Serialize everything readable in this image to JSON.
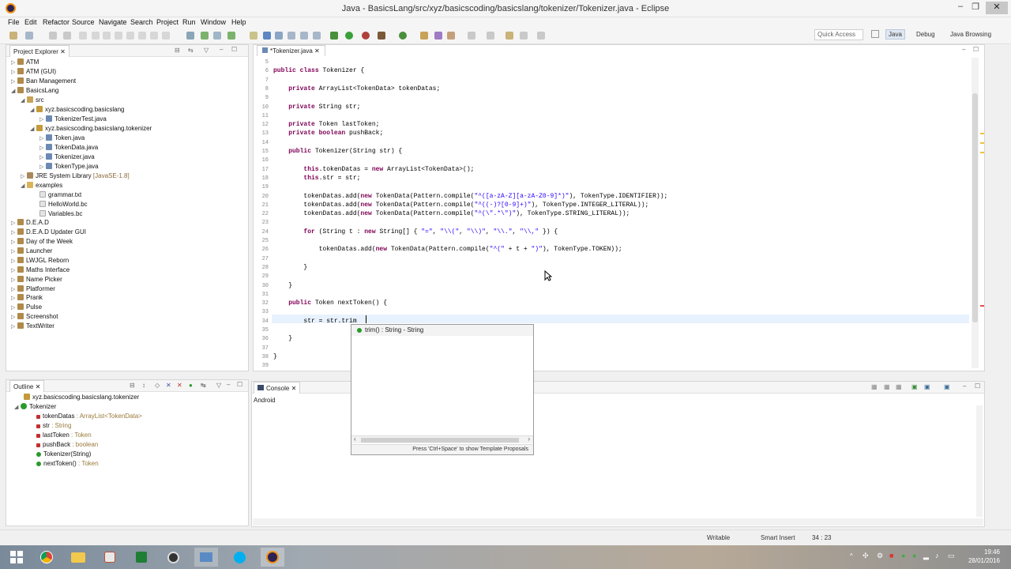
{
  "window": {
    "title": "Java - BasicsLang/src/xyz/basicscoding/basicslang/tokenizer/Tokenizer.java - Eclipse"
  },
  "menu": [
    "File",
    "Edit",
    "Refactor",
    "Source",
    "Navigate",
    "Search",
    "Project",
    "Run",
    "Window",
    "Help"
  ],
  "toolbar": {
    "quick_access": "Quick Access",
    "perspectives": [
      "Java",
      "Debug",
      "Java Browsing"
    ]
  },
  "project_explorer": {
    "title": "Project Explorer",
    "items": [
      {
        "label": "ATM",
        "suffix": ""
      },
      {
        "label": "ATM (GUI)",
        "suffix": ""
      },
      {
        "label": "Ban Management",
        "suffix": ""
      },
      {
        "label": "BasicsLang",
        "suffix": ""
      },
      {
        "label": "src",
        "suffix": ""
      },
      {
        "label": "xyz.basicscoding.basicslang",
        "suffix": ""
      },
      {
        "label": "TokenizerTest.java",
        "suffix": ""
      },
      {
        "label": "xyz.basicscoding.basicslang.tokenizer",
        "suffix": ""
      },
      {
        "label": "Token.java",
        "suffix": ""
      },
      {
        "label": "TokenData.java",
        "suffix": ""
      },
      {
        "label": "Tokenizer.java",
        "suffix": ""
      },
      {
        "label": "TokenType.java",
        "suffix": ""
      },
      {
        "label": "JRE System Library",
        "suffix": "[JavaSE-1.8]"
      },
      {
        "label": "examples",
        "suffix": ""
      },
      {
        "label": "grammar.txt",
        "suffix": ""
      },
      {
        "label": "HelloWorld.bc",
        "suffix": ""
      },
      {
        "label": "Variables.bc",
        "suffix": ""
      },
      {
        "label": "D.E.A.D",
        "suffix": ""
      },
      {
        "label": "D.E.A.D Updater GUI",
        "suffix": ""
      },
      {
        "label": "Day of the Week",
        "suffix": ""
      },
      {
        "label": "Launcher",
        "suffix": ""
      },
      {
        "label": "LWJGL Reborn",
        "suffix": ""
      },
      {
        "label": "Maths Interface",
        "suffix": ""
      },
      {
        "label": "Name Picker",
        "suffix": ""
      },
      {
        "label": "Platformer",
        "suffix": ""
      },
      {
        "label": "Prank",
        "suffix": ""
      },
      {
        "label": "Pulse",
        "suffix": ""
      },
      {
        "label": "Screenshot",
        "suffix": ""
      },
      {
        "label": "TextWriter",
        "suffix": ""
      }
    ]
  },
  "outline": {
    "title": "Outline",
    "items": [
      {
        "label": "xyz.basicscoding.basicslang.tokenizer",
        "suffix": ""
      },
      {
        "label": "Tokenizer",
        "suffix": ""
      },
      {
        "label": "tokenDatas",
        "suffix": " : ArrayList<TokenData>"
      },
      {
        "label": "str",
        "suffix": " : String"
      },
      {
        "label": "lastToken",
        "suffix": " : Token"
      },
      {
        "label": "pushBack",
        "suffix": " : boolean"
      },
      {
        "label": "Tokenizer(String)",
        "suffix": ""
      },
      {
        "label": "nextToken()",
        "suffix": " : Token"
      }
    ]
  },
  "editor": {
    "tab": "*Tokenizer.java",
    "lines": [
      {
        "n": "5",
        "t": ""
      },
      {
        "n": "6",
        "t": "public class Tokenizer {"
      },
      {
        "n": "7",
        "t": ""
      },
      {
        "n": "8",
        "t": "    private ArrayList<TokenData> tokenDatas;"
      },
      {
        "n": "9",
        "t": ""
      },
      {
        "n": "10",
        "t": "    private String str;"
      },
      {
        "n": "11",
        "t": ""
      },
      {
        "n": "12",
        "t": "    private Token lastToken;"
      },
      {
        "n": "13",
        "t": "    private boolean pushBack;"
      },
      {
        "n": "14",
        "t": ""
      },
      {
        "n": "15",
        "t": "    public Tokenizer(String str) {"
      },
      {
        "n": "16",
        "t": ""
      },
      {
        "n": "17",
        "t": "        this.tokenDatas = new ArrayList<TokenData>();"
      },
      {
        "n": "18",
        "t": "        this.str = str;"
      },
      {
        "n": "19",
        "t": ""
      },
      {
        "n": "20",
        "t": "        tokenDatas.add(new TokenData(Pattern.compile(\"^([a-zA-Z][a-zA-Z0-9]*)\"), TokenType.IDENTIFIER));"
      },
      {
        "n": "21",
        "t": "        tokenDatas.add(new TokenData(Pattern.compile(\"^((-)?[0-9]+)\"), TokenType.INTEGER_LITERAL));"
      },
      {
        "n": "22",
        "t": "        tokenDatas.add(new TokenData(Pattern.compile(\"^(\\\".*\\\")\"), TokenType.STRING_LITERAL));"
      },
      {
        "n": "23",
        "t": ""
      },
      {
        "n": "24",
        "t": "        for (String t : new String[] { \"=\", \"\\\\(\", \"\\\\)\", \"\\\\.\", \"\\\\,\" }) {"
      },
      {
        "n": "25",
        "t": ""
      },
      {
        "n": "26",
        "t": "            tokenDatas.add(new TokenData(Pattern.compile(\"^(\" + t + \")\"), TokenType.TOKEN));"
      },
      {
        "n": "27",
        "t": ""
      },
      {
        "n": "28",
        "t": "        }"
      },
      {
        "n": "29",
        "t": ""
      },
      {
        "n": "30",
        "t": "    }"
      },
      {
        "n": "31",
        "t": ""
      },
      {
        "n": "32",
        "t": "    public Token nextToken() {"
      },
      {
        "n": "33",
        "t": ""
      },
      {
        "n": "34",
        "t": "        str = str.trim"
      },
      {
        "n": "35",
        "t": ""
      },
      {
        "n": "36",
        "t": "    }"
      },
      {
        "n": "37",
        "t": ""
      },
      {
        "n": "38",
        "t": "}"
      },
      {
        "n": "39",
        "t": ""
      }
    ]
  },
  "autocomplete": {
    "item": "trim() : String - String",
    "footer": "Press 'Ctrl+Space' to show Template Proposals"
  },
  "console": {
    "tab": "Console",
    "content": "Android"
  },
  "status": {
    "mode": "Writable",
    "insert": "Smart Insert",
    "position": "34 : 23"
  },
  "clock": {
    "time": "19:46",
    "date": "28/01/2016"
  }
}
